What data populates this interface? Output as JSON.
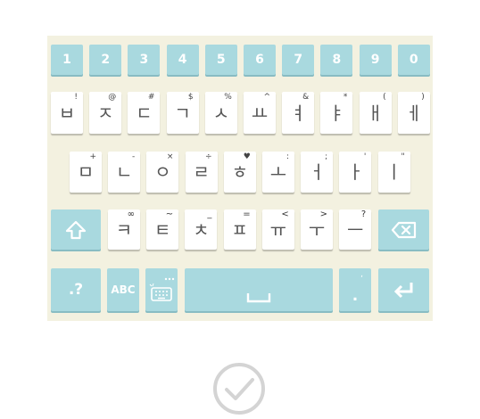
{
  "number_row": [
    "1",
    "2",
    "3",
    "4",
    "5",
    "6",
    "7",
    "8",
    "9",
    "0"
  ],
  "row1": [
    {
      "main": "ㅂ",
      "sub": "!"
    },
    {
      "main": "ㅈ",
      "sub": "@"
    },
    {
      "main": "ㄷ",
      "sub": "#"
    },
    {
      "main": "ㄱ",
      "sub": "$"
    },
    {
      "main": "ㅅ",
      "sub": "%"
    },
    {
      "main": "ㅛ",
      "sub": "^"
    },
    {
      "main": "ㅕ",
      "sub": "&"
    },
    {
      "main": "ㅑ",
      "sub": "*"
    },
    {
      "main": "ㅐ",
      "sub": "("
    },
    {
      "main": "ㅔ",
      "sub": ")"
    }
  ],
  "row2": [
    {
      "main": "ㅁ",
      "sub": "+"
    },
    {
      "main": "ㄴ",
      "sub": "-"
    },
    {
      "main": "ㅇ",
      "sub": "×"
    },
    {
      "main": "ㄹ",
      "sub": "÷"
    },
    {
      "main": "ㅎ",
      "sub": "♥"
    },
    {
      "main": "ㅗ",
      "sub": ":"
    },
    {
      "main": "ㅓ",
      "sub": ";"
    },
    {
      "main": "ㅏ",
      "sub": "'"
    },
    {
      "main": "ㅣ",
      "sub": "\""
    }
  ],
  "row3": [
    {
      "main": "ㅋ",
      "sub": "∞"
    },
    {
      "main": "ㅌ",
      "sub": "~"
    },
    {
      "main": "ㅊ",
      "sub": "_"
    },
    {
      "main": "ㅍ",
      "sub": "="
    },
    {
      "main": "ㅠ",
      "sub": "<"
    },
    {
      "main": "ㅜ",
      "sub": ">"
    },
    {
      "main": "ㅡ",
      "sub": "?"
    }
  ],
  "bottom_row": {
    "symbols_label": ".?",
    "abc_label": "ABC",
    "period_label": ".",
    "period_sub": ","
  },
  "icons": {
    "shift": "shift-icon",
    "backspace": "backspace-icon",
    "emoji_keyboard": "keyboard-settings-icon",
    "space": "space-icon",
    "enter": "enter-icon",
    "confirm": "check-circle-icon"
  },
  "colors": {
    "keyboard_bg": "#f3f1e0",
    "accent_key": "#a9d9df",
    "letter_key": "#ffffff",
    "check": "#d4d4d4"
  }
}
